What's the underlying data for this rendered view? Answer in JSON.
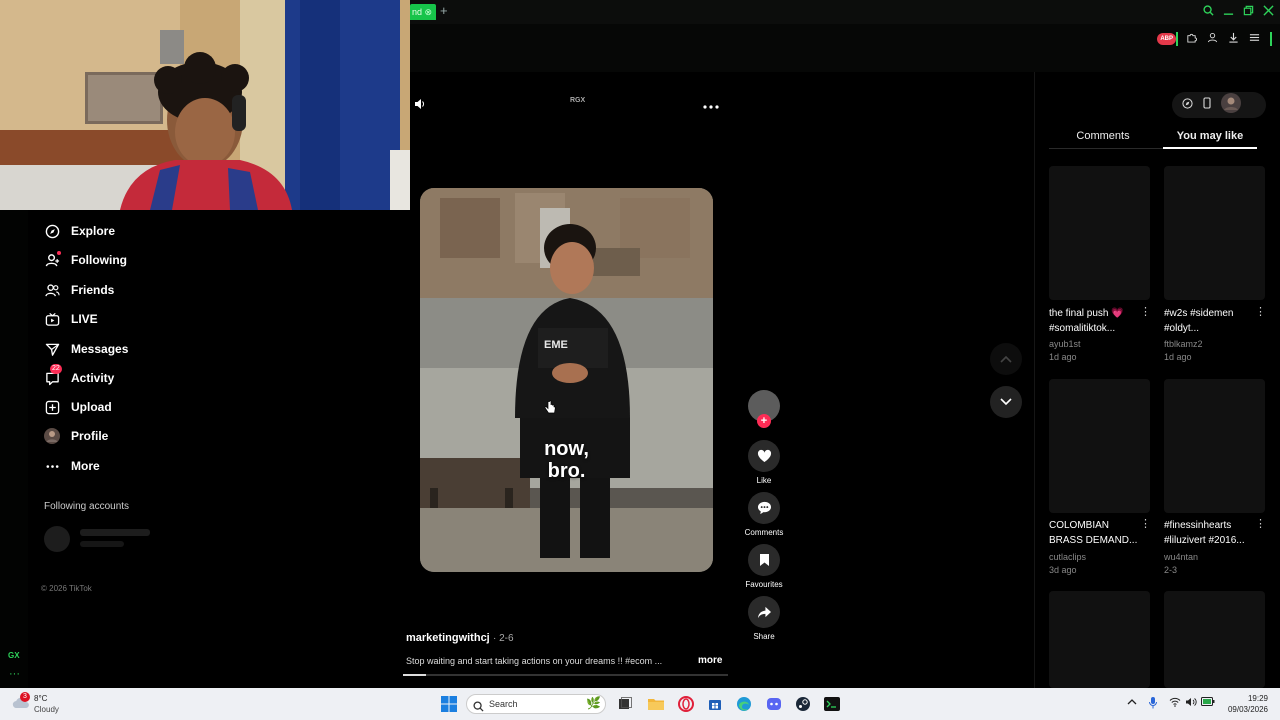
{
  "browser": {
    "active_tab_text": "nd",
    "new_tab_glyph": "+",
    "window_controls": [
      "search-icon",
      "minimize-icon",
      "restore-icon",
      "close-icon"
    ],
    "accent_color": "#2ed35a",
    "adblock_label": "ABP",
    "extension_icons": [
      "puzzle-icon",
      "account-icon",
      "download-icon",
      "menu-icon"
    ]
  },
  "gx": {
    "label": "GX",
    "more": "···"
  },
  "sidebar": {
    "items": [
      {
        "label": "Explore",
        "icon": "compass-icon"
      },
      {
        "label": "Following",
        "icon": "following-icon"
      },
      {
        "label": "Friends",
        "icon": "friends-icon"
      },
      {
        "label": "LIVE",
        "icon": "live-icon"
      },
      {
        "label": "Messages",
        "icon": "messages-icon"
      },
      {
        "label": "Activity",
        "icon": "activity-icon",
        "badge": "22"
      },
      {
        "label": "Upload",
        "icon": "upload-icon"
      },
      {
        "label": "Profile",
        "icon": "avatar"
      },
      {
        "label": "More",
        "icon": "more-icon"
      }
    ],
    "following_title": "Following accounts",
    "copyright": "© 2026 TikTok"
  },
  "video": {
    "top_label": "RGX",
    "caption_line1": "now,",
    "caption_line2": "bro.",
    "username": "marketingwithcj",
    "date": "· 2-6",
    "description": "Stop waiting and start taking actions on your dreams !! #ecom ...",
    "more": "more",
    "progress": 0.07
  },
  "actions": {
    "like": "Like",
    "comments": "Comments",
    "favourites": "Favourites",
    "share": "Share",
    "follow_glyph": "+"
  },
  "right_panel": {
    "tabs": [
      "Comments",
      "You may like"
    ],
    "active_tab": "You may like",
    "cards": [
      {
        "title_l1": "the final push",
        "title_l2": "#somalitiktok...",
        "heart": "💗",
        "author": "ayub1st",
        "date": "1d ago"
      },
      {
        "title_l1": "#w2s #sidemen",
        "title_l2": "#oldyt...",
        "author": "ftblkamz2",
        "date": "1d ago"
      },
      {
        "title_l1": "COLOMBIAN",
        "title_l2": "BRASS DEMAND...",
        "author": "cutlaclips",
        "date": "3d ago"
      },
      {
        "title_l1": "#finessinhearts",
        "title_l2": "#liluzivert #2016...",
        "author": "wu4ntan",
        "date": "2-3"
      }
    ]
  },
  "taskbar": {
    "weather_badge": "3",
    "temperature": "8°C",
    "condition": "Cloudy",
    "search_placeholder": "Search",
    "time": "19:29",
    "date": "09/03/2026"
  }
}
